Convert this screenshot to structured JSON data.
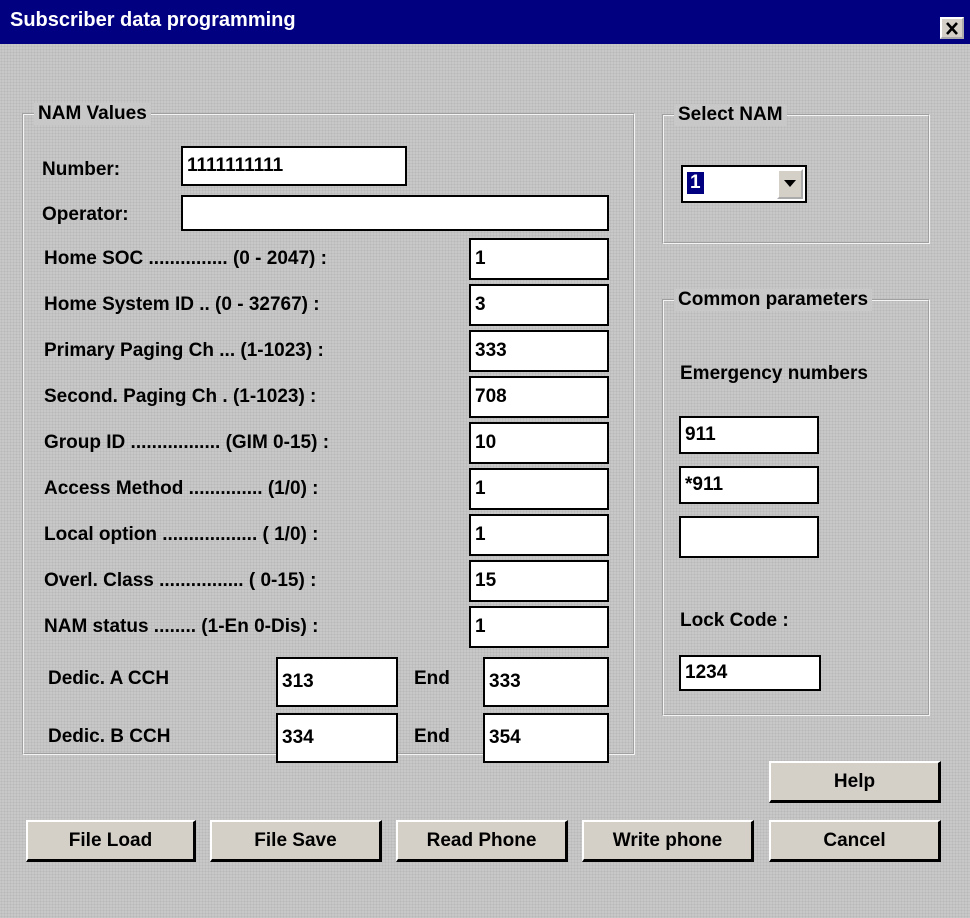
{
  "window": {
    "title": "Subscriber data programming",
    "close_icon": "close-icon"
  },
  "nam_values": {
    "legend": "NAM  Values",
    "number": {
      "label": "Number:",
      "value": "1111111111"
    },
    "operator": {
      "label": "Operator:",
      "value": ""
    },
    "rows": [
      {
        "label": "Home SOC ............... (0 - 2047) :",
        "value": "1"
      },
      {
        "label": "Home System ID .. (0 - 32767) :",
        "value": "3"
      },
      {
        "label": "Primary Paging Ch ... (1-1023) :",
        "value": "333"
      },
      {
        "label": "Second.  Paging Ch . (1-1023) :",
        "value": "708"
      },
      {
        "label": "Group ID ................. (GIM 0-15) :",
        "value": "10"
      },
      {
        "label": "Access Method .............. (1/0) :",
        "value": "1"
      },
      {
        "label": "Local option .................. ( 1/0) :",
        "value": "1"
      },
      {
        "label": "Overl. Class  ................ ( 0-15) :",
        "value": "15"
      },
      {
        "label": "NAM status ........ (1-En 0-Dis) :",
        "value": "1"
      }
    ],
    "dedic_a": {
      "label": "Dedic.  A CCH",
      "start": "313",
      "end_label": "End",
      "end": "333"
    },
    "dedic_b": {
      "label": "Dedic.  B CCH",
      "start": "334",
      "end_label": "End",
      "end": "354"
    }
  },
  "select_nam": {
    "legend": "Select NAM",
    "selected": "1",
    "dropdown_icon": "chevron-down-icon"
  },
  "common": {
    "legend": "Common parameters",
    "emergency_label": "Emergency numbers",
    "emergency": [
      "911",
      "*911",
      ""
    ],
    "lock_code_label": "Lock Code :",
    "lock_code": "1234"
  },
  "buttons": {
    "help": "Help",
    "file_load": "File Load",
    "file_save": "File Save",
    "read_phone": "Read Phone",
    "write_phone": "Write phone",
    "cancel": "Cancel"
  }
}
